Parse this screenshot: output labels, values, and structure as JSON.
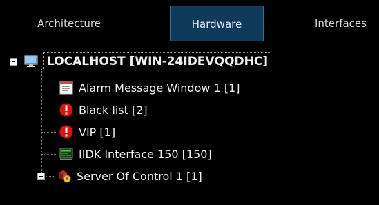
{
  "tabs": [
    {
      "label": "Architecture",
      "active": false
    },
    {
      "label": "Hardware",
      "active": true
    },
    {
      "label": "Interfaces",
      "active": false
    }
  ],
  "tree": {
    "root": {
      "label": "LOCALHOST [WIN-24IDEVQQDHC]",
      "icon": "computer-icon",
      "expanded": true
    },
    "children": [
      {
        "label": "Alarm Message Window 1 [1]",
        "icon": "alarm-window-icon"
      },
      {
        "label": "Black list [2]",
        "icon": "alert-icon"
      },
      {
        "label": "VIP [1]",
        "icon": "alert-icon"
      },
      {
        "label": "IIDK Interface 150 [150]",
        "icon": "interface-icon"
      },
      {
        "label": "Server Of Control 1 [1]",
        "icon": "server-control-icon",
        "expanded": false
      }
    ]
  },
  "colors": {
    "background": "#000000",
    "active_tab": "#0f3b5a",
    "alert": "#e01010"
  }
}
